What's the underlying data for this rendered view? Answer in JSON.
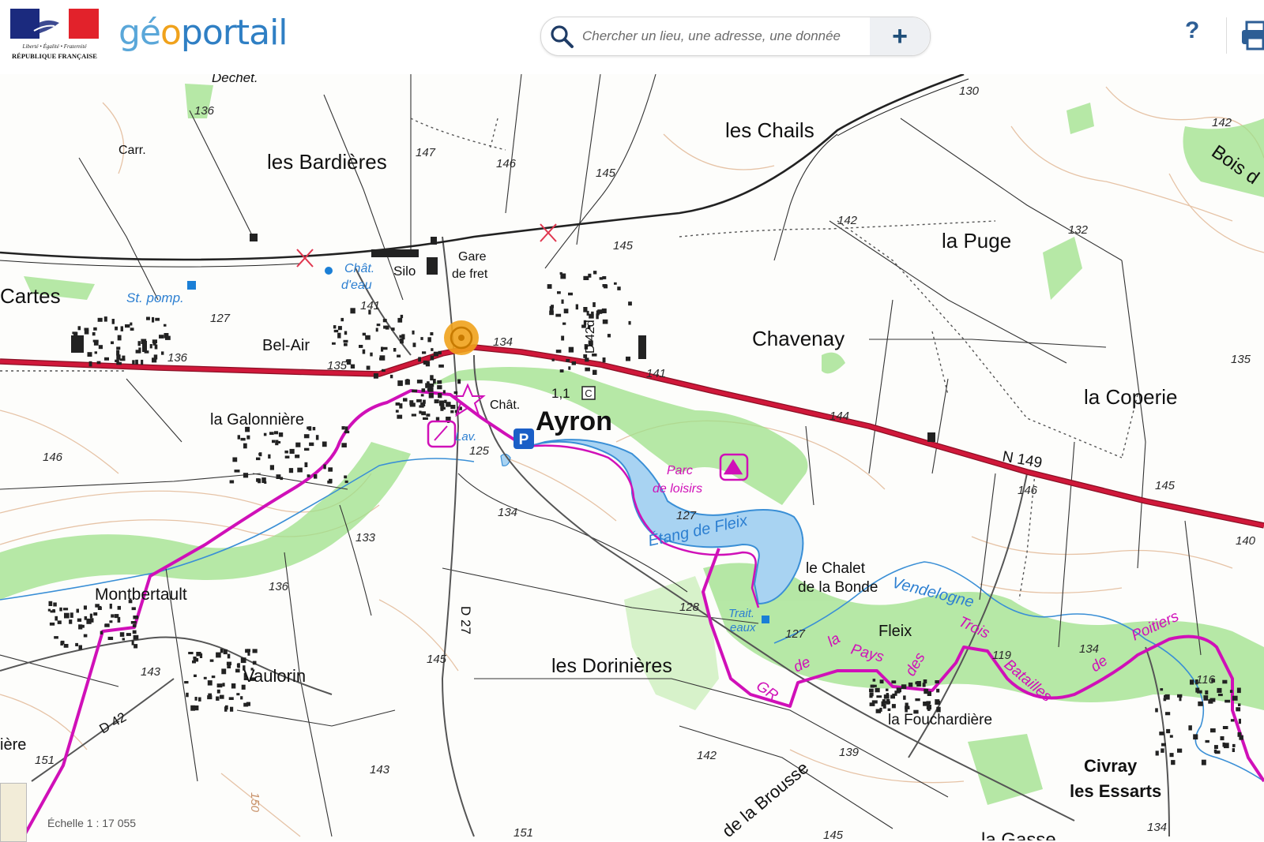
{
  "header": {
    "logo_line1": "Liberté • Égalité • Fraternité",
    "logo_line2": "RÉPUBLIQUE FRANÇAISE",
    "brand_geo": "gé",
    "brand_o": "o",
    "brand_portail": "portail",
    "search_placeholder": "Chercher un lieu, une adresse, une donnée",
    "plus_label": "+",
    "help_label": "?"
  },
  "map": {
    "scale_label": "Échelle 1 : 17 055",
    "colors": {
      "road_red": "#d0183a",
      "trail_magenta": "#e015c8",
      "water": "#a8d3f2",
      "vegetation": "#82d86a",
      "contour": "#e2b99a"
    },
    "places": {
      "dechet": "Dechet.",
      "carr": "Carr.",
      "les_bardieres": "les Bardières",
      "les_chails": "les Chails",
      "la_puge": "la Puge",
      "chavenay": "Chavenay",
      "la_coperie": "la Coperie",
      "bois": "Bois d",
      "cartes": "Cartes",
      "st_pomp": "St. pomp.",
      "chat_eau_1": "Chât.",
      "chat_eau_2": "d'eau",
      "silo": "Silo",
      "gare_1": "Gare",
      "gare_2": "de fret",
      "bel_air": "Bel-Air",
      "d42d": "D 42d",
      "ayron": "Ayron",
      "chat": "Chât.",
      "km": "1,1",
      "c_box": "C",
      "la_galonniere": "la Galonnière",
      "lav": "Lav.",
      "parc_1": "Parc",
      "parc_2": "de loisirs",
      "etang": "Étang de Fleix",
      "n149": "N 149",
      "montbertault": "Montbertault",
      "vaulorin": "Vaulorin",
      "d27": "D 27",
      "d42": "D 42",
      "les_dorinieres": "les Dorinières",
      "chalet_1": "le Chalet",
      "chalet_2": "de la Bonde",
      "vendelogne": "Vendelogne",
      "trait_1": "Trait.",
      "trait_2": "eaux",
      "fleix": "Fleix",
      "la_fouchardiere": "la Fouchardière",
      "civray": "Civray",
      "les_essarts": "les Essarts",
      "la_brousse": "de la Brousse",
      "la_gasse": "la Gasse",
      "gr_1": "GR",
      "gr_2": "de",
      "gr_3": "la",
      "gr_4": "Pays",
      "gr_5": "des",
      "gr_6": "Trois",
      "gr_7": "Batailles",
      "gr_8": "de",
      "gr_9": "Poitiers",
      "iere": "ière"
    },
    "elevations": {
      "e136a": "136",
      "e147": "147",
      "e146a": "146",
      "e145a": "145",
      "e130": "130",
      "e142a": "142",
      "e142b": "142",
      "e132": "132",
      "e145b": "145",
      "e141a": "141",
      "e127a": "127",
      "e136b": "136",
      "e135a": "135",
      "e134a": "134",
      "e141b": "141",
      "e135b": "135",
      "e144": "144",
      "e146b": "146",
      "e146c": "146",
      "e145c": "145",
      "e125": "125",
      "e134b": "134",
      "e127b": "127",
      "e140": "140",
      "e133": "133",
      "e136c": "136",
      "e128": "128",
      "e127c": "127",
      "e119": "119",
      "e134c": "134",
      "e116": "116",
      "e143a": "143",
      "e145d": "145",
      "e151a": "151",
      "e143b": "143",
      "e142c": "142",
      "e139": "139",
      "e151b": "151",
      "e145e": "145",
      "e134d": "134",
      "e150": "150"
    }
  }
}
